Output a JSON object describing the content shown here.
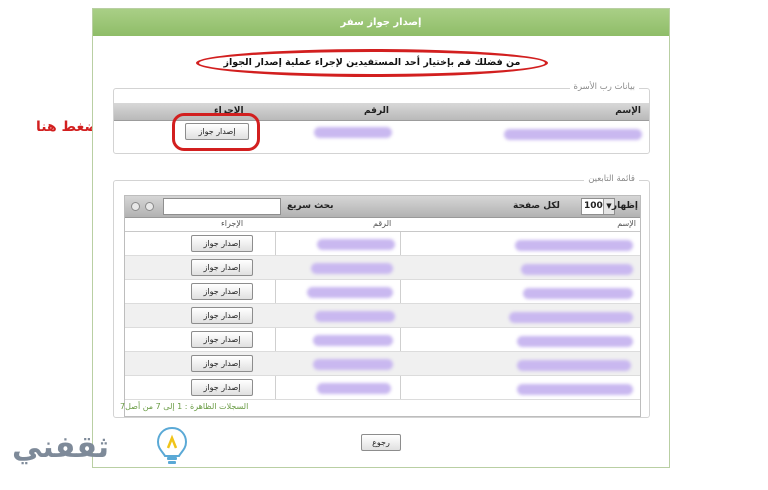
{
  "panel": {
    "title": "إصدار جواز سفر"
  },
  "instruction": "من فضلك قم بإختيار أحد المستفيدين لإجراء عملية إصدار الجواز",
  "head_of_family": {
    "legend": "بيانات رب الأسرة",
    "columns": {
      "name": "الإسم",
      "number": "الرقم",
      "action": "الإجراء"
    },
    "issue_button_label": "إصدار جواز"
  },
  "dependents": {
    "legend": "قائمة التابعين",
    "show_label": "إظهار",
    "page_size": "100",
    "per_page_label": "لكل صفحة",
    "quick_search_label": "بحث سريع",
    "columns": {
      "name": "الإسم",
      "number": "الرقم",
      "action": "الإجراء"
    },
    "rows": [
      {
        "button": "إصدار جواز"
      },
      {
        "button": "إصدار جواز"
      },
      {
        "button": "إصدار جواز"
      },
      {
        "button": "إصدار جواز"
      },
      {
        "button": "إصدار جواز"
      },
      {
        "button": "إصدار جواز"
      },
      {
        "button": "إصدار جواز"
      }
    ],
    "records_info": "السجلات الظاهرة : 1 إلى 7 من أصل7"
  },
  "back_button_label": "رجوع",
  "annotation": {
    "label": "اضغط هنا"
  },
  "logo": {
    "text": "ثقفني"
  },
  "colors": {
    "header_green": "#9cc679",
    "highlight_red": "#d21f1f",
    "redacted": "#c9b8f0"
  }
}
